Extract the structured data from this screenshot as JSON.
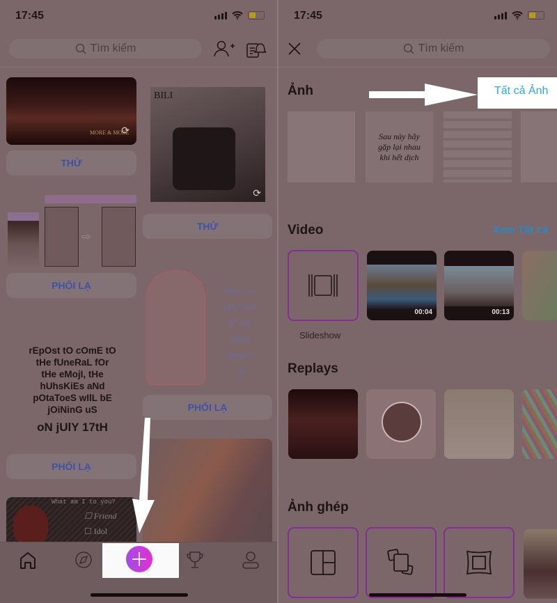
{
  "status_bar": {
    "time": "17:45"
  },
  "left_screen": {
    "search": {
      "placeholder": "Tìm kiếm"
    },
    "header_icons": [
      "add-user-icon",
      "notification-bell-icon"
    ],
    "feed": {
      "card1_button": "THỬ",
      "card2_button": "THỬ",
      "card3_button": "PHỐI LẠ",
      "card4_button": "PHỐI LẠ",
      "card5_button": "PHỐI LẠ",
      "card1_image_text": "MORE & MORE",
      "card2_image_text": "BILI",
      "card4_image_text": [
        "Remix if",
        "your part",
        "of the",
        "bunny",
        "squad!!",
        ":D"
      ],
      "card5_image_text": [
        "rEpOst tO cOmE tO",
        "tHe fUneRaL fOr",
        "tHe eMojI, tHe",
        "hUhsKiEs aNd",
        "pOtaToeS wIlL bE",
        "jOiNinG uS"
      ],
      "card5_image_date": "oN jUlY 17tH",
      "card6_image_text": "What am I to you?",
      "card6_options": [
        "Friend",
        "Idol"
      ]
    },
    "bottom_nav": [
      "home-icon",
      "explore-icon",
      "create-plus-icon",
      "trophy-icon",
      "profile-icon"
    ],
    "highlighted": "create-plus-button"
  },
  "right_screen": {
    "search": {
      "placeholder": "Tìm kiếm"
    },
    "sections": {
      "photos": {
        "title": "Ảnh",
        "link": "Tất cả Ảnh"
      },
      "video": {
        "title": "Video",
        "link": "Xem Tất cả",
        "slideshow_label": "Slideshow",
        "durations": [
          "00:04",
          "00:13"
        ]
      },
      "replays": {
        "title": "Replays"
      },
      "collage": {
        "title": "Ảnh ghép"
      }
    },
    "photo_thumb_text": "Sau này hãy gặp lại nhau khi hết dịch",
    "highlighted": "all-photos-link"
  },
  "colors": {
    "accent_blue": "#2aa7e8",
    "button_text": "#3f52a6",
    "tile_border": "#8a2a94",
    "plus_gradient": [
      "#a24ee6",
      "#e22fd0"
    ],
    "highlight": "#ffffff"
  }
}
